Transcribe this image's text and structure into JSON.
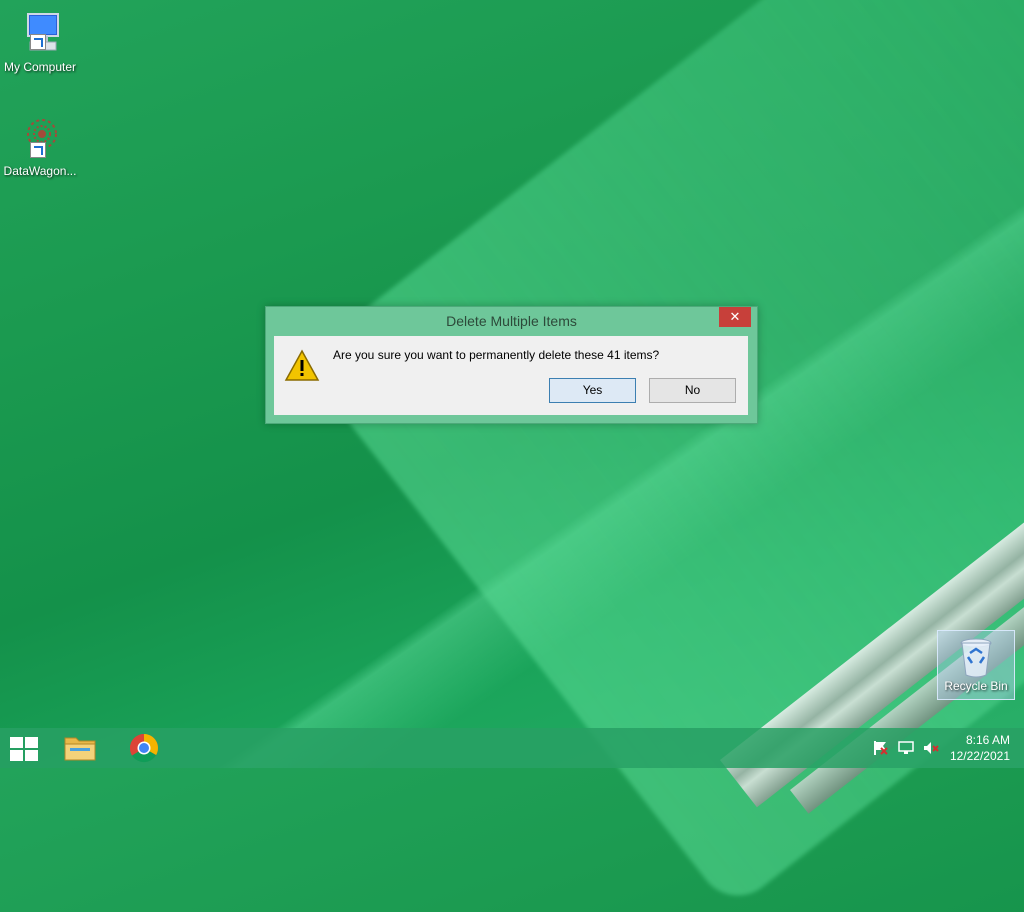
{
  "desktop": {
    "icons": [
      {
        "label": "My Computer",
        "icon": "computer-icon"
      },
      {
        "label": "DataWagon...",
        "icon": "datawagon-icon"
      }
    ],
    "recycle_bin": {
      "label": "Recycle Bin",
      "icon": "recycle-bin-icon"
    }
  },
  "dialog": {
    "title": "Delete Multiple Items",
    "close_label": "✕",
    "message": "Are you sure you want to permanently delete these 41 items?",
    "yes_label": "Yes",
    "no_label": "No",
    "icon": "warning-icon"
  },
  "taskbar": {
    "apps": [
      {
        "name": "file-explorer",
        "icon": "folder-icon"
      },
      {
        "name": "chrome",
        "icon": "chrome-icon"
      }
    ],
    "tray": {
      "time": "8:16 AM",
      "date": "12/22/2021"
    }
  },
  "colors": {
    "background": "#1b9a50",
    "dialog_frame": "#6ec79a",
    "close_button": "#c7403a",
    "taskbar": "#28a064"
  }
}
